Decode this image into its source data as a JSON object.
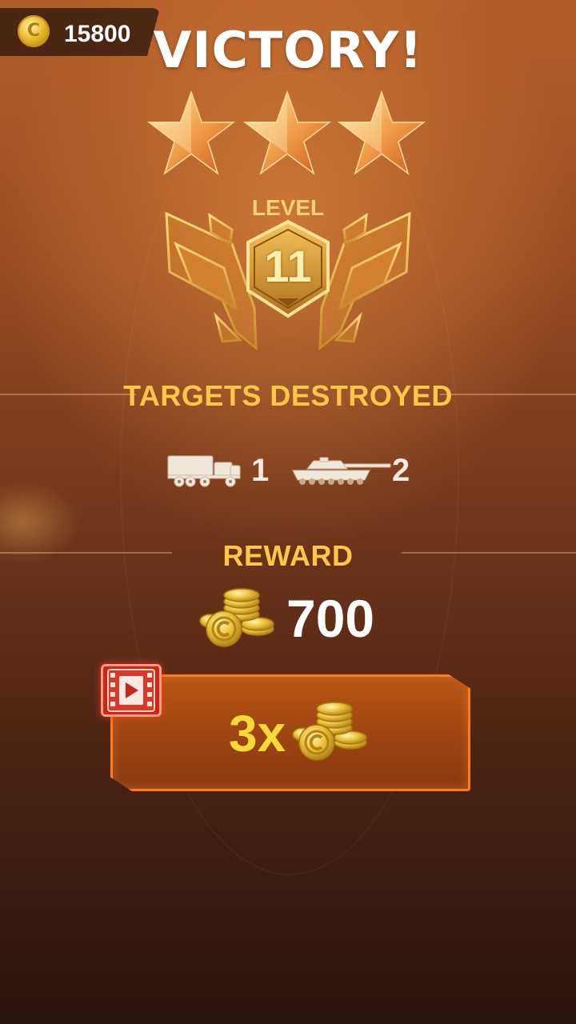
{
  "header": {
    "coin_icon": "coin-icon",
    "coin_balance": "15800"
  },
  "result": {
    "title": "VICTORY!",
    "stars_earned": 3,
    "stars_total": 3
  },
  "level": {
    "label": "LEVEL",
    "number": "11"
  },
  "targets": {
    "title": "TARGETS DESTROYED",
    "items": [
      {
        "icon": "truck-icon",
        "count": "1"
      },
      {
        "icon": "tank-icon",
        "count": "2"
      }
    ]
  },
  "reward": {
    "title": "REWARD",
    "icon": "coin-stack-icon",
    "amount": "700"
  },
  "multiplier_button": {
    "label": "3x",
    "video_icon": "video-ad-icon",
    "coin_icon": "coin-stack-icon"
  },
  "colors": {
    "gold_text": "#ffc74a",
    "button_border": "#ff7a1a",
    "multiplier_text": "#f7d935",
    "video_badge": "#c8281c"
  }
}
